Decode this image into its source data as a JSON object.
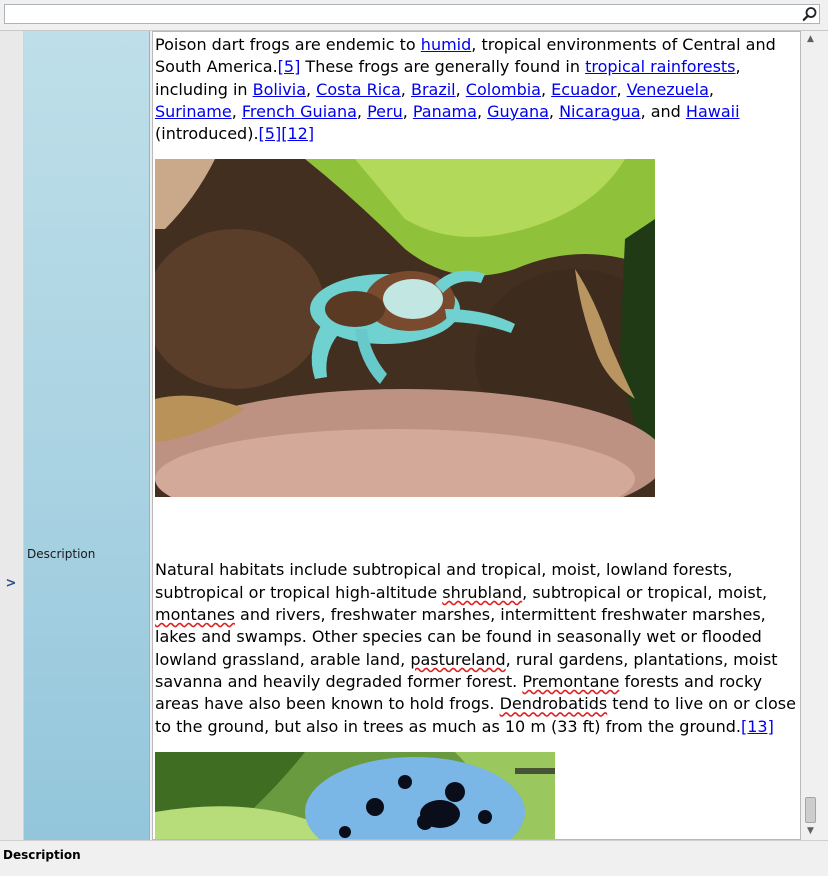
{
  "search": {
    "value": "",
    "placeholder": "",
    "icon": "search-icon"
  },
  "property": {
    "expander": ">",
    "label": "Description"
  },
  "content": {
    "para1": [
      {
        "t": "Poison dart frogs are endemic to "
      },
      {
        "t": "humid",
        "link": true
      },
      {
        "t": ", tropical environments of Central and South America."
      },
      {
        "t": "[5]",
        "link": true
      },
      {
        "t": " These frogs are generally found in "
      },
      {
        "t": "tropical rainforests",
        "link": true
      },
      {
        "t": ", including in "
      },
      {
        "t": "Bolivia",
        "link": true
      },
      {
        "t": ", "
      },
      {
        "t": "Costa Rica",
        "link": true
      },
      {
        "t": ", "
      },
      {
        "t": "Brazil",
        "link": true
      },
      {
        "t": ", "
      },
      {
        "t": "Colombia",
        "link": true
      },
      {
        "t": ", "
      },
      {
        "t": "Ecuador",
        "link": true
      },
      {
        "t": ", "
      },
      {
        "t": "Venezuela",
        "link": true
      },
      {
        "t": ", "
      },
      {
        "t": "Suriname",
        "link": true
      },
      {
        "t": ", "
      },
      {
        "t": "French Guiana",
        "link": true
      },
      {
        "t": ", "
      },
      {
        "t": "Peru",
        "link": true
      },
      {
        "t": ", "
      },
      {
        "t": "Panama",
        "link": true
      },
      {
        "t": ", "
      },
      {
        "t": "Guyana",
        "link": true
      },
      {
        "t": ", "
      },
      {
        "t": "Nicaragua",
        "link": true
      },
      {
        "t": ", and "
      },
      {
        "t": "Hawaii",
        "link": true
      },
      {
        "t": " (introduced)."
      },
      {
        "t": "[5]",
        "link": true
      },
      {
        "t": "[12]",
        "link": true
      }
    ],
    "para2": [
      {
        "t": "Natural habitats include subtropical and tropical, moist, lowland forests, subtropical or tropical high-altitude "
      },
      {
        "t": "shrubland",
        "spell": true
      },
      {
        "t": ", subtropical or tropical, moist, "
      },
      {
        "t": "montanes",
        "spell": true
      },
      {
        "t": " and rivers, freshwater marshes, intermittent freshwater marshes, lakes and swamps. Other species can be found in seasonally wet or flooded lowland grassland, arable land, "
      },
      {
        "t": "pastureland",
        "spell": true
      },
      {
        "t": ", rural gardens, plantations, moist savanna and heavily degraded former forest. "
      },
      {
        "t": "Premontane",
        "spell": true
      },
      {
        "t": " forests and rocky areas have also been known to hold frogs. "
      },
      {
        "t": "Dendrobatids",
        "spell": true
      },
      {
        "t": " tend to live on or close to the ground, but also in trees as much as 10 m (33 ft) from the ground."
      },
      {
        "t": "[13]",
        "link": true
      }
    ]
  },
  "scrollbar": {
    "up": "▲",
    "down": "▼",
    "position": 0.95
  },
  "footer": {
    "title": "Description"
  },
  "colors": {
    "link": "#0000ee",
    "label_cell": "#a9d2e2",
    "spell": "#dd2222"
  }
}
